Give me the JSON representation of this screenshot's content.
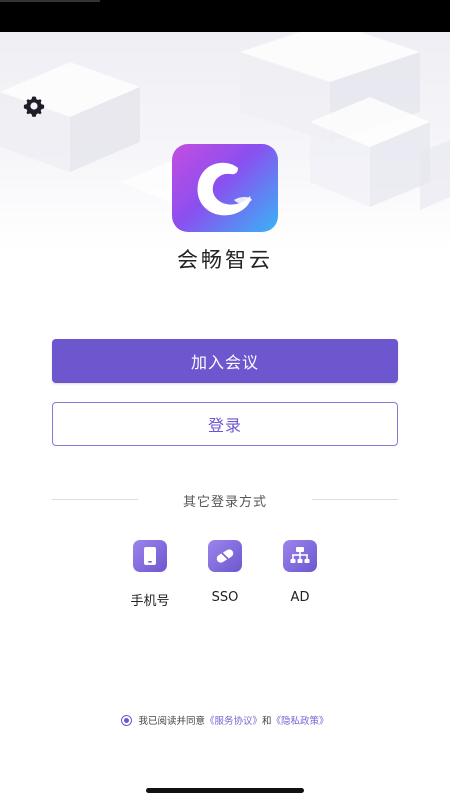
{
  "app": {
    "name": "会畅智云"
  },
  "actions": {
    "join_meeting": "加入会议",
    "login": "登录"
  },
  "other_login": {
    "title": "其它登录方式",
    "methods": [
      {
        "label": "手机号",
        "icon": "phone-icon"
      },
      {
        "label": "SSO",
        "icon": "sso-icon"
      },
      {
        "label": "AD",
        "icon": "ad-icon"
      }
    ]
  },
  "agreement": {
    "prefix": "我已阅读并同意",
    "service_link": "《服务协议》",
    "conjunction": "和",
    "privacy_link": "《隐私政策》",
    "checked": true
  },
  "colors": {
    "accent": "#6e56cf",
    "logo_gradient": [
      "#c44ee0",
      "#8b4ff0",
      "#37b4f5"
    ]
  }
}
